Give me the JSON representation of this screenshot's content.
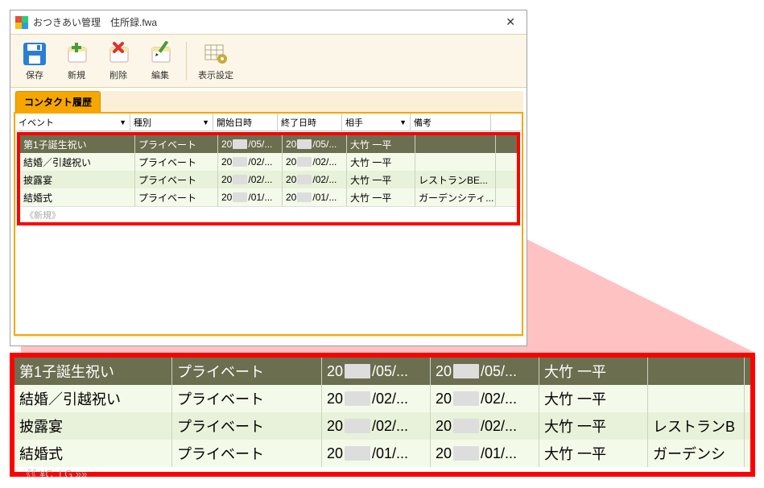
{
  "window": {
    "title": "おつきあい管理　住所録.fwa"
  },
  "toolbar": {
    "save": "保存",
    "new": "新規",
    "delete": "削除",
    "edit": "編集",
    "display": "表示設定"
  },
  "tab": {
    "label": "コンタクト履歴"
  },
  "columns": {
    "event": "イベント",
    "type": "種別",
    "start": "開始日時",
    "end": "終了日時",
    "partner": "相手",
    "notes": "備考"
  },
  "rows": [
    {
      "event": "第1子誕生祝い",
      "type": "プライベート",
      "start_a": "20",
      "start_b": "/05/...",
      "end_a": "20",
      "end_b": "/05/...",
      "partner": "大竹 一平",
      "notes": ""
    },
    {
      "event": "結婚／引越祝い",
      "type": "プライベート",
      "start_a": "20",
      "start_b": "/02/...",
      "end_a": "20",
      "end_b": "/02/...",
      "partner": "大竹 一平",
      "notes": ""
    },
    {
      "event": "披露宴",
      "type": "プライベート",
      "start_a": "20",
      "start_b": "/02/...",
      "end_a": "20",
      "end_b": "/02/...",
      "partner": "大竹 一平",
      "notes": "レストランBE..."
    },
    {
      "event": "結婚式",
      "type": "プライベート",
      "start_a": "20",
      "start_b": "/01/...",
      "end_a": "20",
      "end_b": "/01/...",
      "partner": "大竹 一平",
      "notes": "ガーデンシティ..."
    }
  ],
  "new_row_label": "《新規》",
  "big_rows": [
    {
      "event": "第1子誕生祝い",
      "type": "プライベート",
      "start_a": "20",
      "start_b": "/05/...",
      "end_a": "20",
      "end_b": "/05/...",
      "partner": "大竹 一平",
      "notes": ""
    },
    {
      "event": "結婚／引越祝い",
      "type": "プライベート",
      "start_a": "20",
      "start_b": "/02/...",
      "end_a": "20",
      "end_b": "/02/...",
      "partner": "大竹 一平",
      "notes": ""
    },
    {
      "event": "披露宴",
      "type": "プライベート",
      "start_a": "20",
      "start_b": "/02/...",
      "end_a": "20",
      "end_b": "/02/...",
      "partner": "大竹 一平",
      "notes": "レストランB"
    },
    {
      "event": "結婚式",
      "type": "プライベート",
      "start_a": "20",
      "start_b": "/01/...",
      "end_a": "20",
      "end_b": "/01/...",
      "partner": "大竹 一平",
      "notes": "ガーデンシ"
    }
  ],
  "big_new_label": "《《 ¥C .I.G »»"
}
